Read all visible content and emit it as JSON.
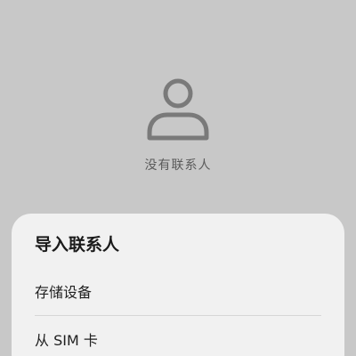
{
  "empty_state": {
    "icon": "person-icon",
    "label": "没有联系人"
  },
  "import_sheet": {
    "title": "导入联系人",
    "options": [
      {
        "label": "存储设备"
      },
      {
        "label": "从 SIM 卡"
      }
    ]
  },
  "colors": {
    "background": "#c8c8c8",
    "sheet": "#f1f1f1",
    "icon": "#7a7a7a"
  }
}
